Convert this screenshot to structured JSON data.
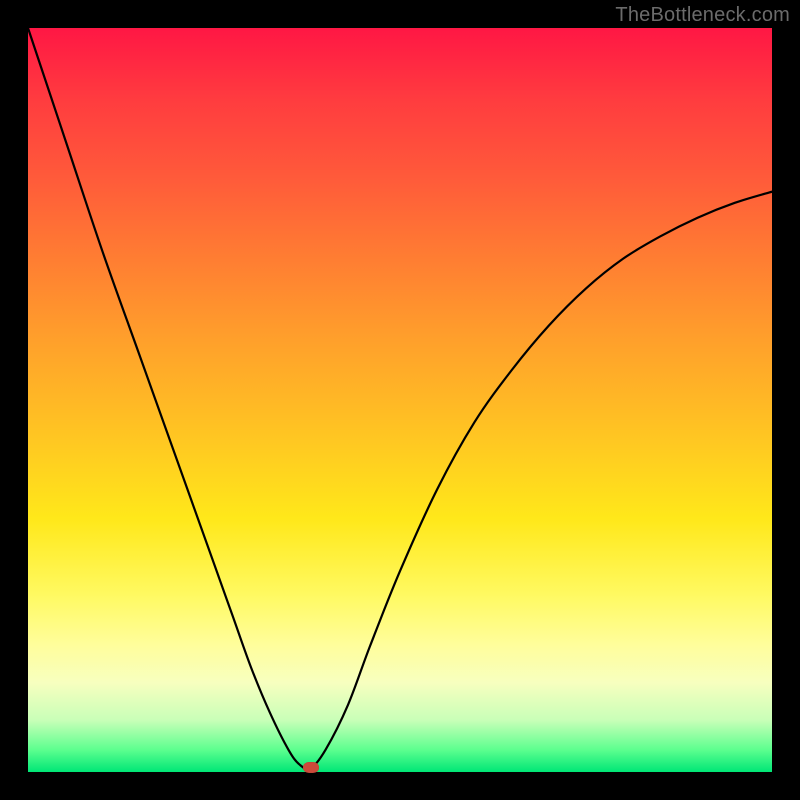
{
  "watermark": "TheBottleneck.com",
  "chart_data": {
    "type": "line",
    "title": "",
    "xlabel": "",
    "ylabel": "",
    "xlim": [
      0,
      100
    ],
    "ylim": [
      0,
      100
    ],
    "series": [
      {
        "name": "curve",
        "x": [
          0,
          5,
          10,
          15,
          20,
          25,
          27.5,
          30,
          32.5,
          35,
          36.5,
          38,
          40,
          43,
          46,
          50,
          55,
          60,
          65,
          70,
          75,
          80,
          85,
          90,
          95,
          100
        ],
        "y": [
          100,
          85,
          70,
          56,
          42,
          28,
          21,
          14,
          8,
          3,
          1,
          0.5,
          3,
          9,
          17,
          27,
          38,
          47,
          54,
          60,
          65,
          69,
          72,
          74.5,
          76.5,
          78
        ]
      }
    ],
    "marker": {
      "x": 38,
      "y": 0.5
    },
    "gradient_stops": [
      {
        "pos": 0,
        "color": "#ff1744"
      },
      {
        "pos": 50,
        "color": "#ffd21a"
      },
      {
        "pos": 90,
        "color": "#fdff8a"
      },
      {
        "pos": 100,
        "color": "#00e676"
      }
    ]
  }
}
